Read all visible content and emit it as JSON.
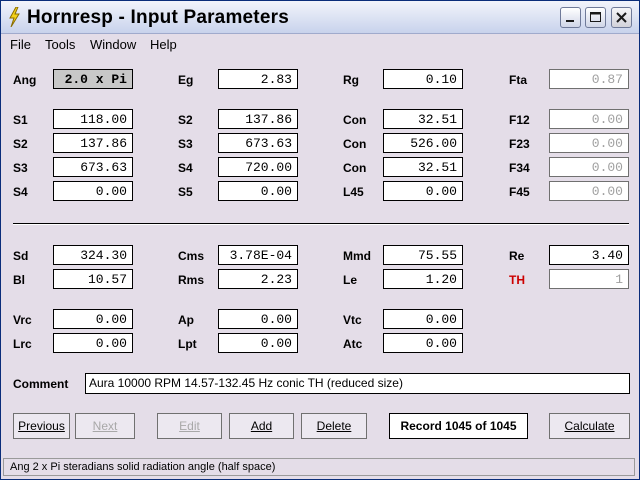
{
  "window": {
    "title": "Hornresp - Input Parameters"
  },
  "menu": [
    "File",
    "Tools",
    "Window",
    "Help"
  ],
  "params": {
    "Ang": {
      "label": "Ang",
      "value": "2.0 x Pi"
    },
    "Eg": {
      "label": "Eg",
      "value": "2.83"
    },
    "Rg": {
      "label": "Rg",
      "value": "0.10"
    },
    "Fta": {
      "label": "Fta",
      "value": "0.87"
    },
    "S1": {
      "label": "S1",
      "value": "118.00"
    },
    "S2a": {
      "label": "S2",
      "value": "137.86"
    },
    "Con1": {
      "label": "Con",
      "value": "32.51"
    },
    "F12": {
      "label": "F12",
      "value": "0.00"
    },
    "S2": {
      "label": "S2",
      "value": "137.86"
    },
    "S3a": {
      "label": "S3",
      "value": "673.63"
    },
    "Con2": {
      "label": "Con",
      "value": "526.00"
    },
    "F23": {
      "label": "F23",
      "value": "0.00"
    },
    "S3": {
      "label": "S3",
      "value": "673.63"
    },
    "S4a": {
      "label": "S4",
      "value": "720.00"
    },
    "Con3": {
      "label": "Con",
      "value": "32.51"
    },
    "F34": {
      "label": "F34",
      "value": "0.00"
    },
    "S4": {
      "label": "S4",
      "value": "0.00"
    },
    "S5": {
      "label": "S5",
      "value": "0.00"
    },
    "L45": {
      "label": "L45",
      "value": "0.00"
    },
    "F45": {
      "label": "F45",
      "value": "0.00"
    },
    "Sd": {
      "label": "Sd",
      "value": "324.30"
    },
    "Cms": {
      "label": "Cms",
      "value": "3.78E-04"
    },
    "Mmd": {
      "label": "Mmd",
      "value": "75.55"
    },
    "Re": {
      "label": "Re",
      "value": "3.40"
    },
    "Bl": {
      "label": "Bl",
      "value": "10.57"
    },
    "Rms": {
      "label": "Rms",
      "value": "2.23"
    },
    "Le": {
      "label": "Le",
      "value": "1.20"
    },
    "TH": {
      "label": "TH",
      "value": "1"
    },
    "Vrc": {
      "label": "Vrc",
      "value": "0.00"
    },
    "Ap": {
      "label": "Ap",
      "value": "0.00"
    },
    "Vtc": {
      "label": "Vtc",
      "value": "0.00"
    },
    "Lrc": {
      "label": "Lrc",
      "value": "0.00"
    },
    "Lpt": {
      "label": "Lpt",
      "value": "0.00"
    },
    "Atc": {
      "label": "Atc",
      "value": "0.00"
    }
  },
  "comment": {
    "label": "Comment",
    "value": "Aura 10000 RPM 14.57-132.45 Hz conic TH (reduced size)"
  },
  "buttons": {
    "previous": "Previous",
    "next": "Next",
    "edit": "Edit",
    "add": "Add",
    "delete": "Delete",
    "calculate": "Calculate"
  },
  "record": "Record 1045 of 1045",
  "status": "Ang   2 x Pi steradians solid radiation angle  (half space)",
  "colors": {
    "th_label": "#cc0000",
    "disabled_text": "#a0a0a0"
  }
}
